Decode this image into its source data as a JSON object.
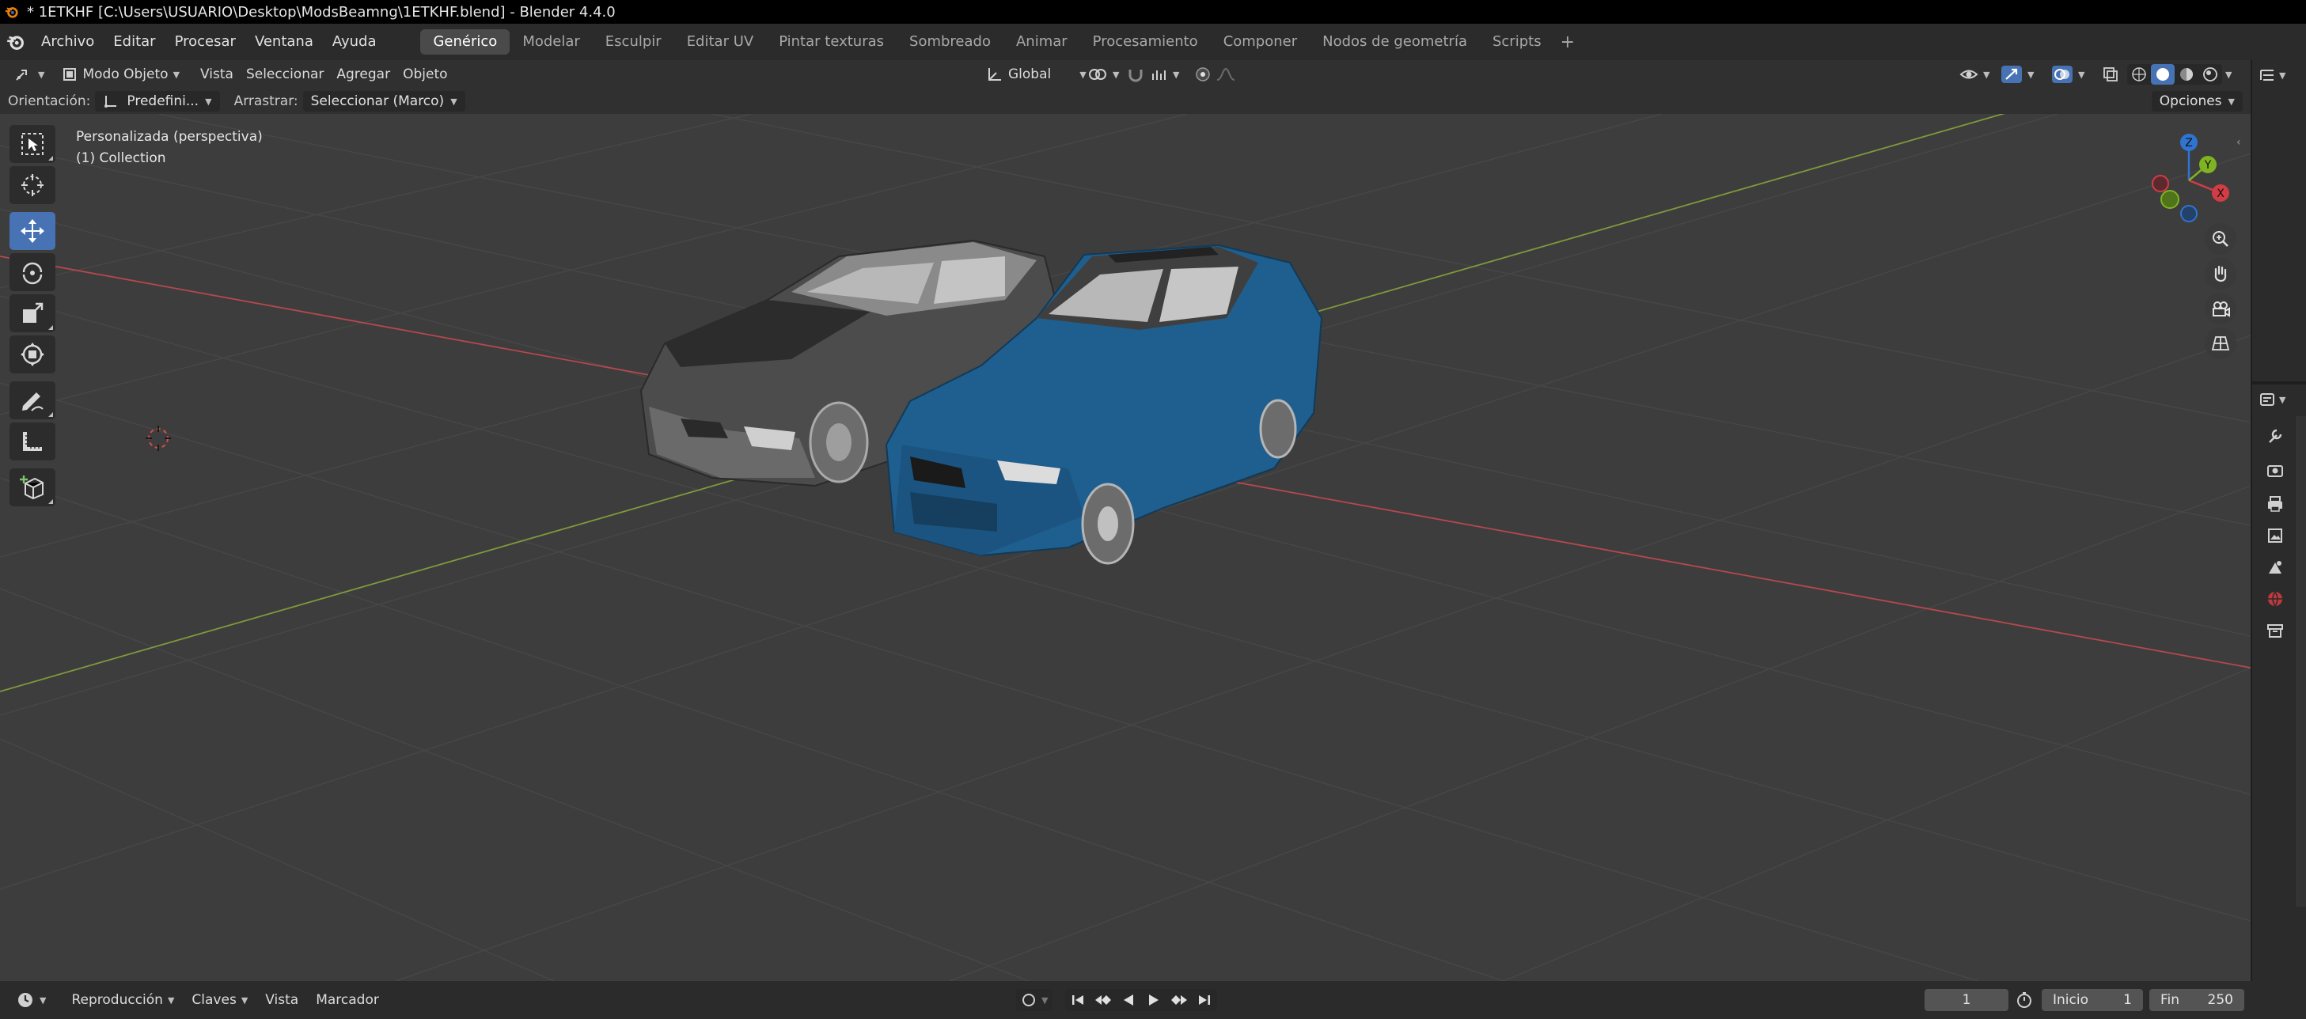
{
  "window": {
    "title": "* 1ETKHF [C:\\Users\\USUARIO\\Desktop\\ModsBeamng\\1ETKHF.blend] - Blender 4.4.0"
  },
  "menu": [
    "Archivo",
    "Editar",
    "Procesar",
    "Ventana",
    "Ayuda"
  ],
  "workspaces": [
    "Genérico",
    "Modelar",
    "Esculpir",
    "Editar UV",
    "Pintar texturas",
    "Sombreado",
    "Animar",
    "Procesamiento",
    "Componer",
    "Nodos de geometría",
    "Scripts"
  ],
  "active_workspace": "Genérico",
  "viewport_header": {
    "mode": "Modo Objeto",
    "menus": [
      "Vista",
      "Seleccionar",
      "Agregar",
      "Objeto"
    ],
    "transform_orientation": "Global"
  },
  "tool_settings": {
    "orientation_label": "Orientación:",
    "orientation_value": "Predefini...",
    "drag_label": "Arrastrar:",
    "drag_value": "Seleccionar (Marco)",
    "options_label": "Opciones"
  },
  "viewport": {
    "view_name": "Personalizada (perspectiva)",
    "collection": "(1) Collection",
    "background_color": "#3d3d3d",
    "x_axis_color": "#b5484f",
    "y_axis_color": "#7e9a3c"
  },
  "gizmo_axes": {
    "x": "X",
    "y": "Y",
    "z": "Z"
  },
  "tools": [
    "select-box",
    "cursor",
    "move",
    "rotate",
    "scale",
    "transform",
    "annotate",
    "measure",
    "add-cube"
  ],
  "active_tool": "move",
  "objects": [
    {
      "name": "car-grey",
      "color": "#5a5a5a"
    },
    {
      "name": "car-blue",
      "color": "#1f5f8f"
    }
  ],
  "timeline": {
    "menus": [
      "Reproducción",
      "Claves",
      "Vista",
      "Marcador"
    ],
    "current_frame": "1",
    "start_label": "Inicio",
    "start_value": "1",
    "end_label": "Fin",
    "end_value": "250"
  },
  "colors": {
    "accent": "#4772b3",
    "header": "#303030",
    "panel": "#2b2b2b"
  }
}
